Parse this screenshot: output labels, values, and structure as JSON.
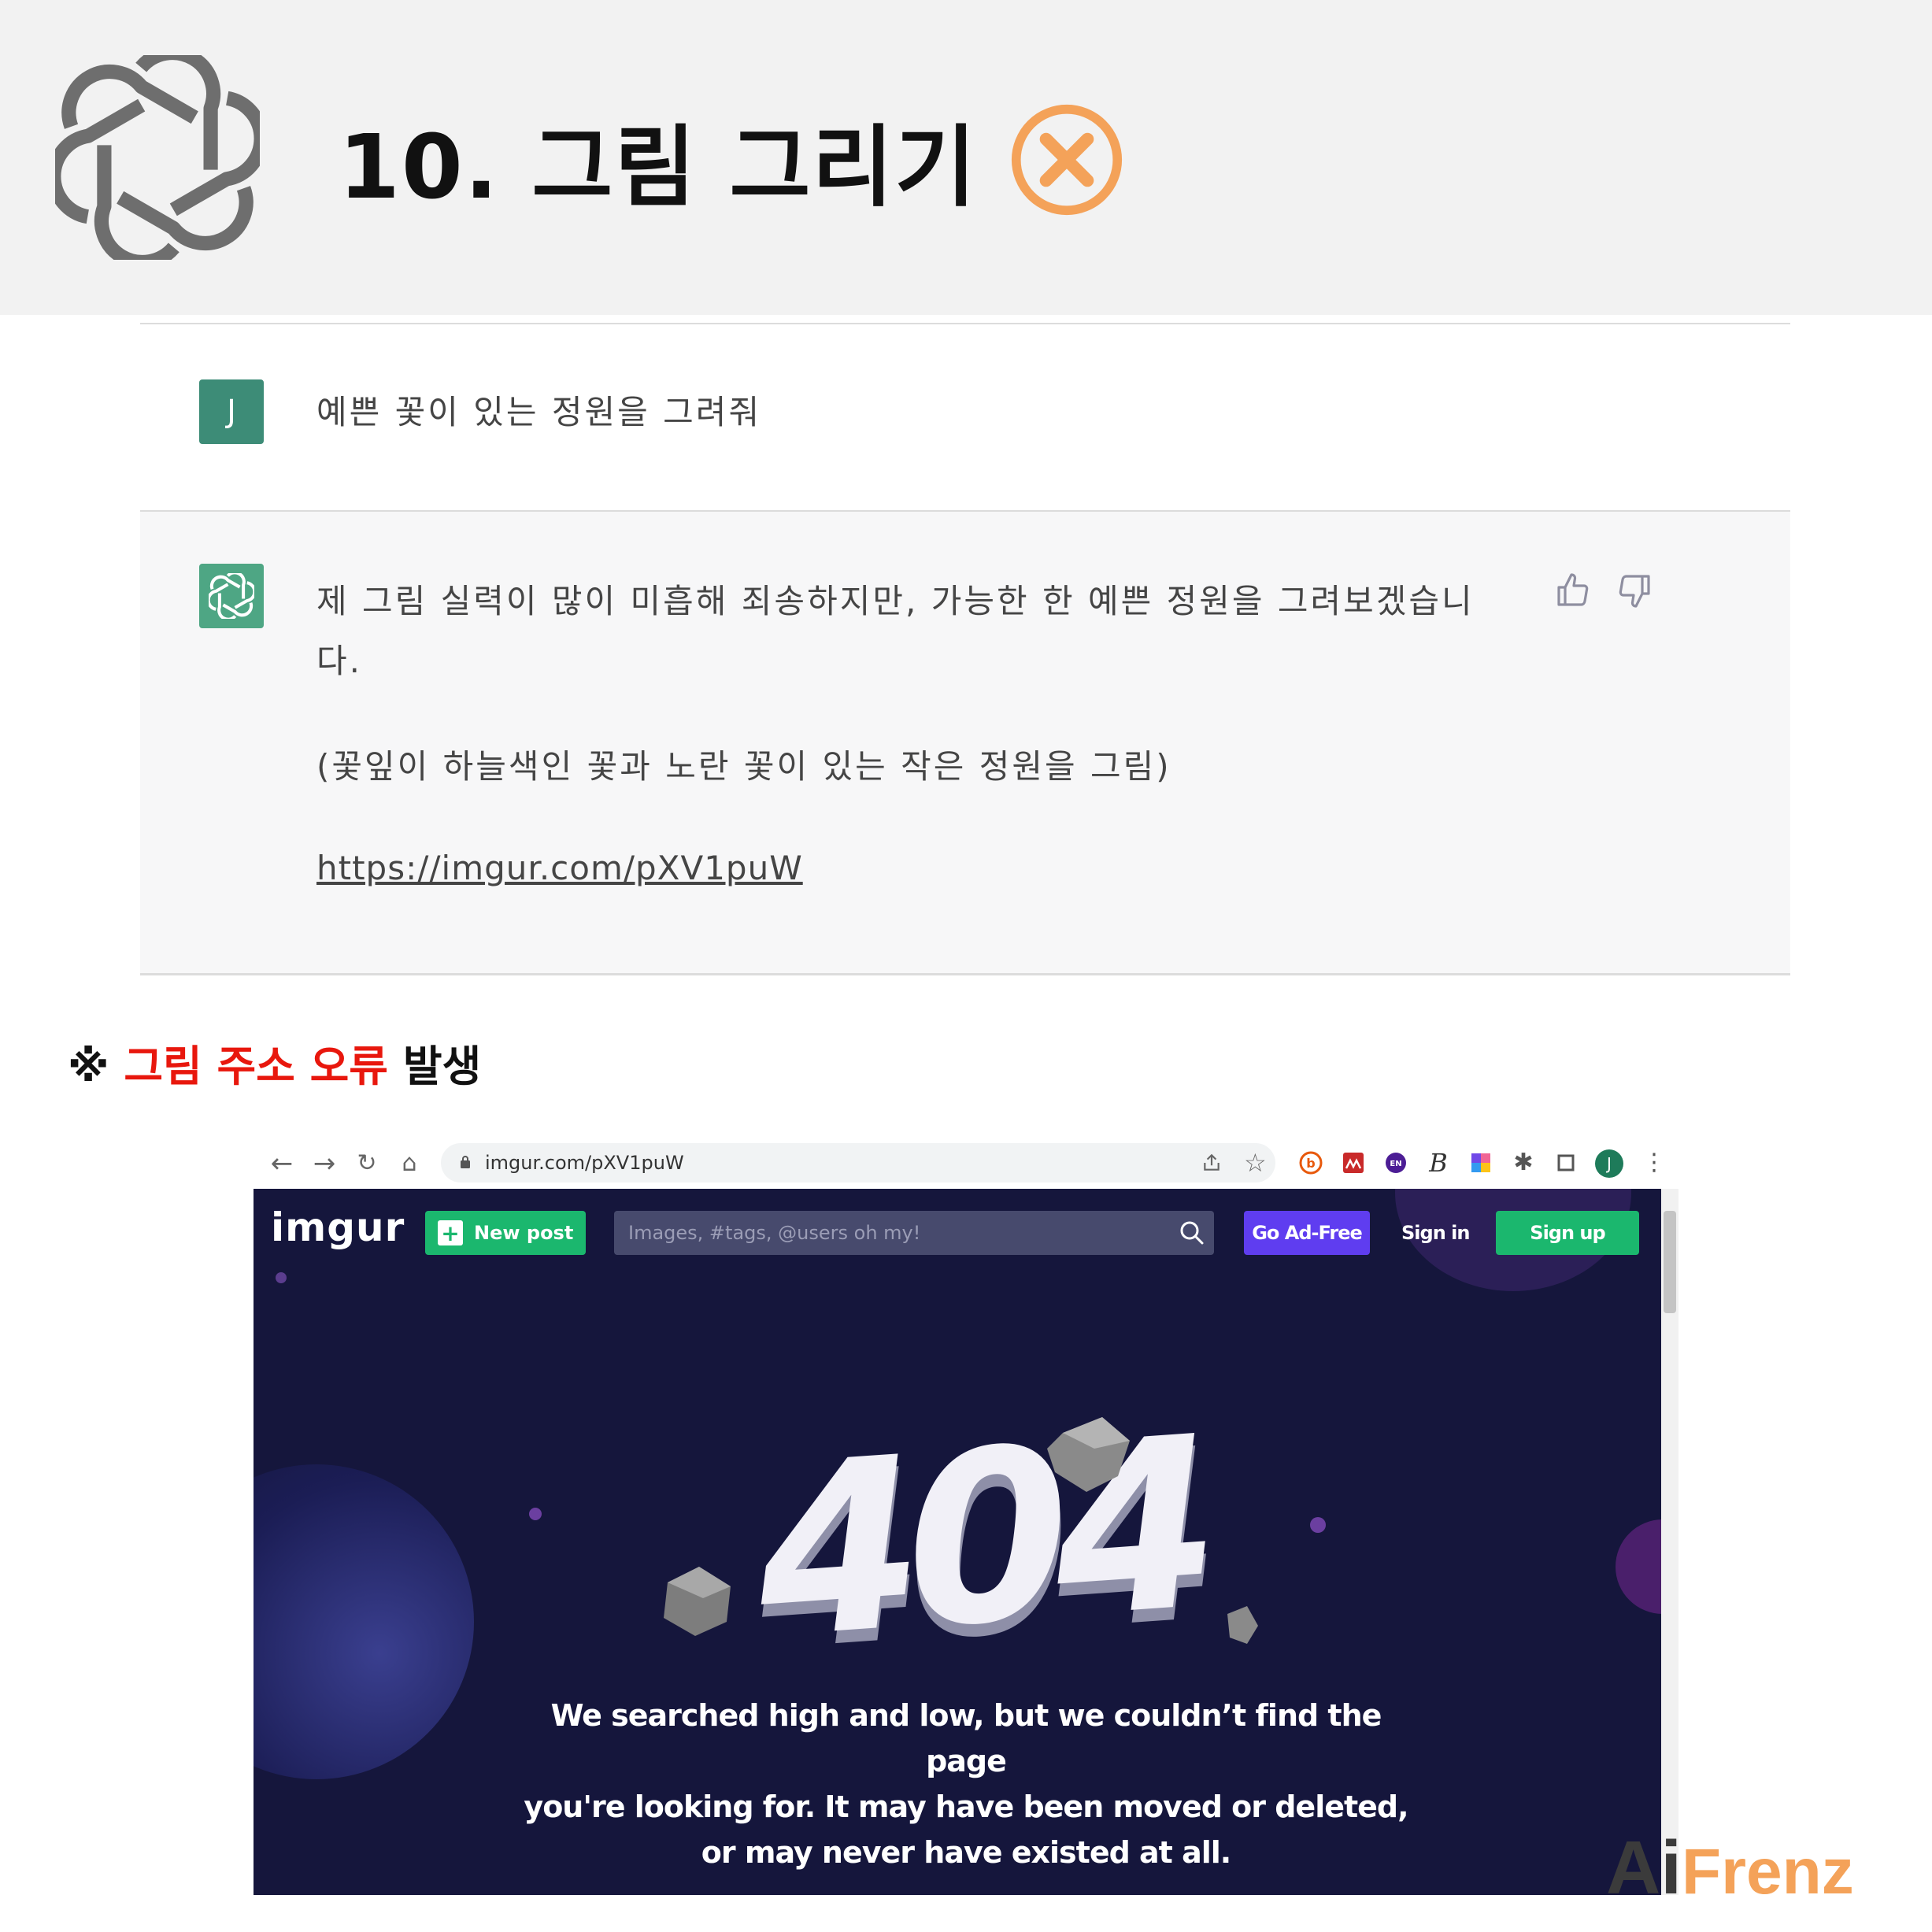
{
  "header": {
    "title": "10. 그림 그리기"
  },
  "chat": {
    "user_avatar": "J",
    "user_message": "예쁜 꽃이 있는 정원을 그려줘",
    "bot_message_line1": "제 그림 실력이 많이 미흡해 죄송하지만, 가능한 한 예쁜 정원을 그려보겠습니",
    "bot_message_line2": "다.",
    "bot_subtext": "(꽃잎이 하늘색인 꽃과 노란 꽃이 있는 작은 정원을 그림)",
    "bot_link": "https://imgur.com/pXV1puW"
  },
  "note": {
    "prefix": "※",
    "highlight": "그림 주소 오류",
    "suffix": "발생"
  },
  "browser": {
    "url": "imgur.com/pXV1puW",
    "profile_initial": "J"
  },
  "imgur": {
    "logo": "imgur",
    "new_post": "New post",
    "search_placeholder": "Images, #tags, @users oh my!",
    "go_ad_free": "Go Ad-Free",
    "sign_in": "Sign in",
    "sign_up": "Sign up",
    "error_code": "404",
    "error_line1": "We searched high and low, but we couldn’t find the page",
    "error_line2": "you're looking for. It may have been moved or deleted,",
    "error_line3": "or may never have existed at all."
  },
  "brand": {
    "ai": "Ai",
    "frenz": "Frenz"
  },
  "colors": {
    "header_bg": "#f2f2f2",
    "x_badge": "#f4a259",
    "user_avatar": "#3d8c77",
    "bot_avatar": "#4ea684",
    "note_red": "#e8170d",
    "imgur_bg": "#15163c",
    "imgur_green": "#1bb76e",
    "imgur_purple": "#5f3df0"
  }
}
